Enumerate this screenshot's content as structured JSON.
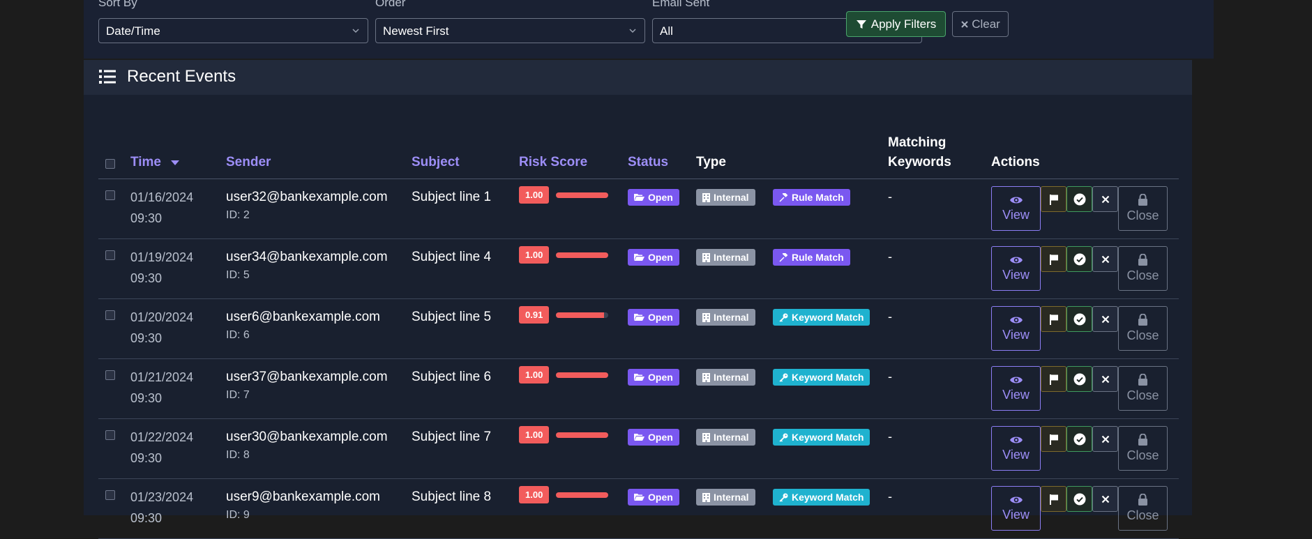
{
  "filters": {
    "sort_by": {
      "label": "Sort By",
      "value": "Date/Time"
    },
    "order": {
      "label": "Order",
      "value": "Newest First"
    },
    "email_sent": {
      "label": "Email Sent",
      "value": "All"
    },
    "apply_label": "Apply Filters",
    "clear_label": "Clear"
  },
  "panel": {
    "title": "Recent Events"
  },
  "columns": {
    "time": "Time",
    "sender": "Sender",
    "subject": "Subject",
    "risk": "Risk Score",
    "status": "Status",
    "type": "Type",
    "keywords_1": "Matching",
    "keywords_2": "Keywords",
    "actions": "Actions"
  },
  "action_labels": {
    "view": "View",
    "close": "Close"
  },
  "colors": {
    "accent": "#9d8ef7",
    "risk": "#f25c5c",
    "keyword_match": "#1fb2cf",
    "rule_match": "#7a58f0",
    "apply": "#1e4b33"
  },
  "rows": [
    {
      "date": "01/16/2024",
      "time": "09:30",
      "email": "user32@bankexample.com",
      "id": "ID: 2",
      "subject": "Subject line 1",
      "risk": "1.00",
      "risk_value": 1.0,
      "status": "Open",
      "type": "Internal",
      "match": "Rule Match",
      "match_kind": "rule",
      "keywords": "-"
    },
    {
      "date": "01/19/2024",
      "time": "09:30",
      "email": "user34@bankexample.com",
      "id": "ID: 5",
      "subject": "Subject line 4",
      "risk": "1.00",
      "risk_value": 1.0,
      "status": "Open",
      "type": "Internal",
      "match": "Rule Match",
      "match_kind": "rule",
      "keywords": "-"
    },
    {
      "date": "01/20/2024",
      "time": "09:30",
      "email": "user6@bankexample.com",
      "id": "ID: 6",
      "subject": "Subject line 5",
      "risk": "0.91",
      "risk_value": 0.91,
      "status": "Open",
      "type": "Internal",
      "match": "Keyword Match",
      "match_kind": "keyword",
      "keywords": "-"
    },
    {
      "date": "01/21/2024",
      "time": "09:30",
      "email": "user37@bankexample.com",
      "id": "ID: 7",
      "subject": "Subject line 6",
      "risk": "1.00",
      "risk_value": 1.0,
      "status": "Open",
      "type": "Internal",
      "match": "Keyword Match",
      "match_kind": "keyword",
      "keywords": "-"
    },
    {
      "date": "01/22/2024",
      "time": "09:30",
      "email": "user30@bankexample.com",
      "id": "ID: 8",
      "subject": "Subject line 7",
      "risk": "1.00",
      "risk_value": 1.0,
      "status": "Open",
      "type": "Internal",
      "match": "Keyword Match",
      "match_kind": "keyword",
      "keywords": "-"
    },
    {
      "date": "01/23/2024",
      "time": "09:30",
      "email": "user9@bankexample.com",
      "id": "ID: 9",
      "subject": "Subject line 8",
      "risk": "1.00",
      "risk_value": 1.0,
      "status": "Open",
      "type": "Internal",
      "match": "Keyword Match",
      "match_kind": "keyword",
      "keywords": "-"
    }
  ]
}
